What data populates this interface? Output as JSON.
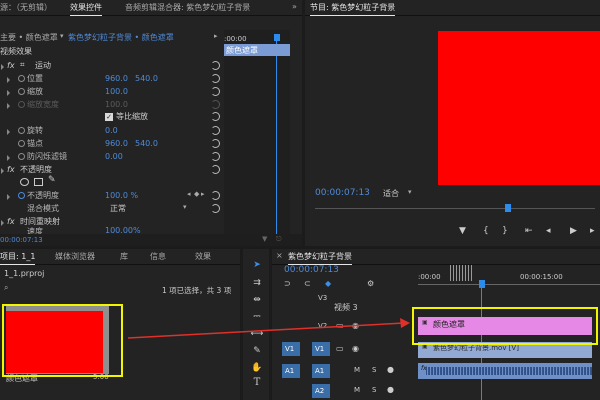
{
  "top_left": {
    "tabs": [
      "源：（无剪辑）",
      "效果控件",
      "音频剪辑混合器: 紫色梦幻粒子背景"
    ],
    "breadcrumb_left": "主要 • 颜色遮罩",
    "breadcrumb_right": "紫色梦幻粒子背景 • 颜色遮罩",
    "timecode_start": ":00:00",
    "clip_label": "颜色遮罩",
    "video_effects": "视频效果",
    "fx": "fx",
    "motion": "运动",
    "position": {
      "label": "位置",
      "x": "960.0",
      "y": "540.0"
    },
    "scale": {
      "label": "缩放",
      "value": "100.0"
    },
    "scale_width": {
      "label": "缩放宽度",
      "value": "100.0"
    },
    "uniform_scale": "等比缩放",
    "rotation": {
      "label": "旋转",
      "value": "0.0"
    },
    "anchor": {
      "label": "锚点",
      "x": "960.0",
      "y": "540.0"
    },
    "anti_flicker": {
      "label": "防闪烁滤镜",
      "value": "0.00"
    },
    "opacity_group": "不透明度",
    "opacity": {
      "label": "不透明度",
      "value": "100.0 %"
    },
    "blend": {
      "label": "混合模式",
      "value": "正常"
    },
    "time_remap": "时间重映射",
    "speed": {
      "label": "速度",
      "value": "100.00%"
    },
    "footer_timecode": "00:00:07:13"
  },
  "program": {
    "title": "节目: 紫色梦幻粒子背景",
    "timecode": "00:00:07:13",
    "fit": "适合",
    "frame_color": "#ff0000"
  },
  "project": {
    "tabs": [
      "项目: 1_1",
      "媒体浏览器",
      "库",
      "信息",
      "效果"
    ],
    "filename": "1_1.prproj",
    "selection": "1 项已选择，共 3 项",
    "clip_name": "颜色遮罩",
    "clip_duration": "5:00"
  },
  "timeline": {
    "title": "紫色梦幻粒子背景",
    "timecode": "00:00:07:13",
    "ruler_start": ":00:00",
    "ruler_mid": "00:00:15:00",
    "tracks": {
      "v3": "V3",
      "video3": "视频 3",
      "v2": "V2",
      "v1": "V1",
      "v1_src": "V1",
      "a1": "A1",
      "a1_src": "A1",
      "a2": "A2",
      "m": "M",
      "s": "S"
    },
    "clip_v2": "颜色遮罩",
    "clip_v1": "紫色梦幻粒子背景.mov [V]",
    "clip_a1": "fx",
    "clip_v2_color": "#e689e6",
    "clip_v1_color": "#92a9d4",
    "clip_a1_color": "#6f8fc7"
  }
}
